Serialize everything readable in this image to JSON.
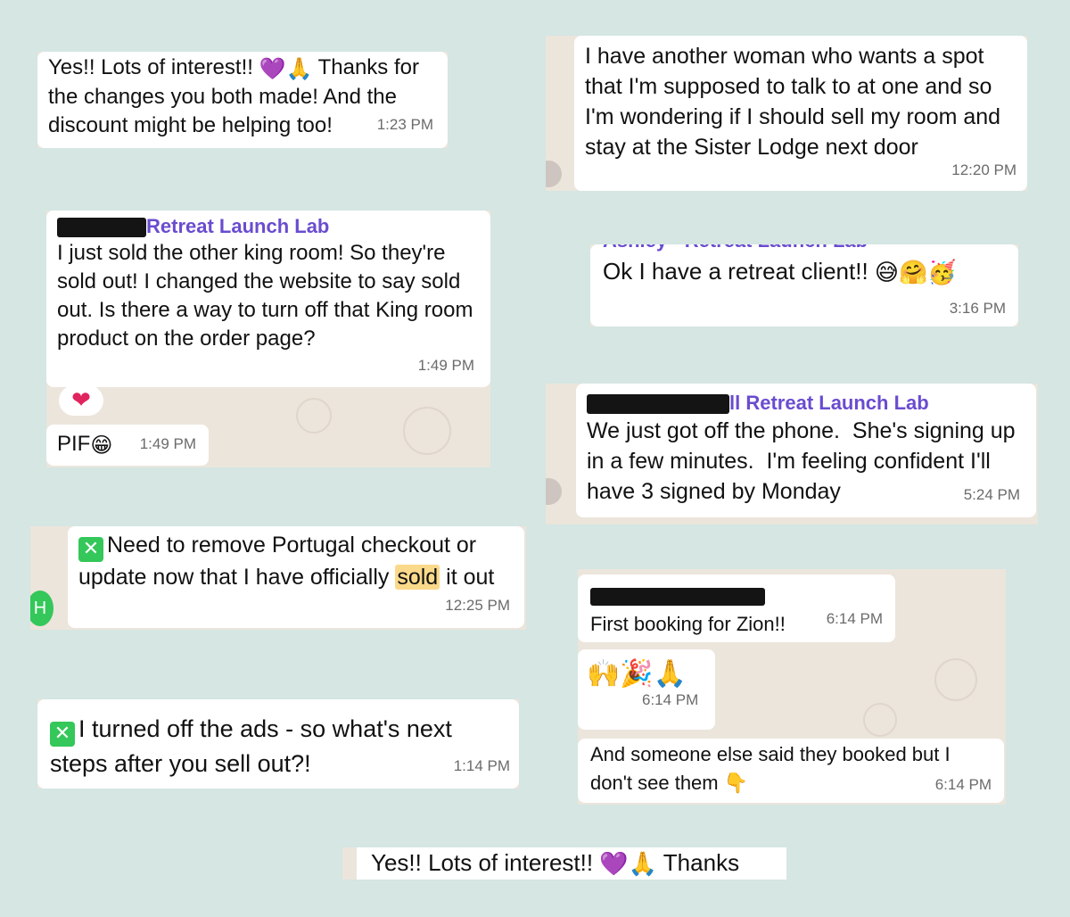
{
  "colors": {
    "background": "#d5e6e3",
    "chat_bg": "#ece5dc",
    "bubble": "#ffffff",
    "sender": "#6a4ccf",
    "checkbox": "#34c759",
    "highlight": "#fbd98a"
  },
  "m1": {
    "text_a": "Yes!! Lots of interest!! ",
    "text_b": " Thanks for the changes you both made! And the discount might be helping too!",
    "emoji1": "💜",
    "emoji2": "🙏",
    "time": "1:23 PM"
  },
  "m2": {
    "text": "I have another woman who wants a spot that I'm supposed to talk to at one and so I'm wondering if I should sell my room and stay at the Sister Lodge next door",
    "time": "12:20 PM"
  },
  "m3": {
    "sender": "Retreat Launch Lab",
    "text": "I just sold the other king room! So they're sold out! I changed the website to say sold out. Is there a way to turn off that King room product on the order page?",
    "time": "1:49 PM",
    "reaction": "❤",
    "reply_text": "PIF",
    "reply_emoji": "😁",
    "reply_time": "1:49 PM"
  },
  "m4": {
    "sender_cut": "Ashley - Retreat Launch Lab",
    "text": "Ok I have a retreat client!! ",
    "emojis": "😅🤗🥳",
    "time": "3:16 PM"
  },
  "m5": {
    "sender": "ll Retreat Launch Lab",
    "text": "We just got off the phone.  She's signing up in a few minutes.  I'm feeling confident I'll have 3 signed by Monday",
    "time": "5:24 PM"
  },
  "m6": {
    "text_a": "Need to remove Portugal checkout or update now that I have officially ",
    "highlight": "sold",
    "text_b": " it out",
    "time": "12:25 PM",
    "avatar_letter": "H"
  },
  "m7": {
    "text": "First booking for Zion!!",
    "time": "6:14 PM",
    "emojis": "🙌🎉🙏",
    "emoji_time": "6:14 PM",
    "text2": "And someone else said they booked but I don't see them ",
    "emoji2": "👇",
    "time2": "6:14 PM"
  },
  "m8": {
    "text": "I turned off the ads - so what's next steps after you sell out?!",
    "time": "1:14 PM"
  },
  "m9": {
    "text_a": "Yes!! Lots of interest!! ",
    "emoji1": "💜",
    "emoji2": "🙏",
    "text_b": " Thanks"
  }
}
